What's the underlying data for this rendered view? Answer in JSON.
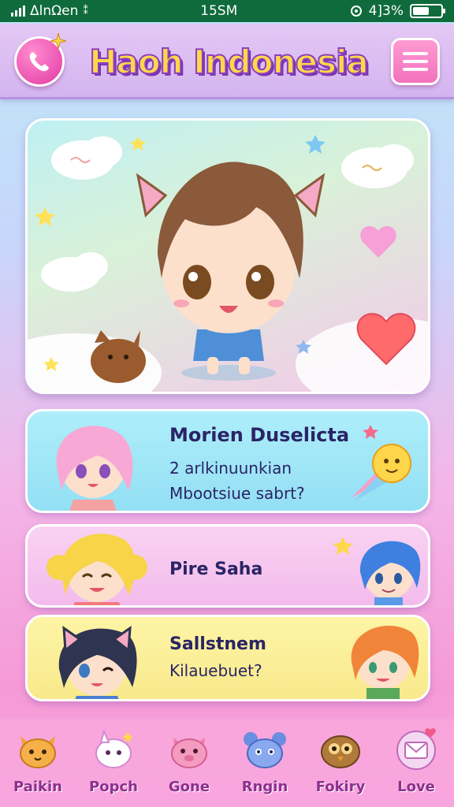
{
  "status_bar": {
    "carrier": "ΔlnΩen",
    "carrier_extra": "⁑",
    "time": "15SM",
    "battery": "4]3%",
    "battery_level_percent": 60
  },
  "header": {
    "title": "Haoh Indonesia"
  },
  "cards": [
    {
      "title": "Morien Duselicta",
      "line1": "2 arlkinuunkian",
      "line2": "Mbootsiue sabrt?"
    },
    {
      "title": "Pire Saha"
    },
    {
      "title": "Sallstnem",
      "line1": "Kilauebuet?"
    }
  ],
  "bottom_nav": [
    {
      "label": "Paikin",
      "icon": "cat-face-icon"
    },
    {
      "label": "Popch",
      "icon": "ghost-bunny-icon"
    },
    {
      "label": "Gone",
      "icon": "pink-pig-icon"
    },
    {
      "label": "Rngin",
      "icon": "blue-mouse-icon"
    },
    {
      "label": "Fokiry",
      "icon": "owl-icon"
    },
    {
      "label": "Love",
      "icon": "love-letter-icon"
    }
  ],
  "colors": {
    "status_bar": "#0f6b3c",
    "header": "#d3b4ef",
    "title_fill": "#ffd84a",
    "title_outline": "#8b3fbf",
    "card_blue": "#93dff4",
    "card_pink": "#f3bbec",
    "card_yellow": "#f8e98b",
    "nav_label": "#8c2f8e"
  }
}
